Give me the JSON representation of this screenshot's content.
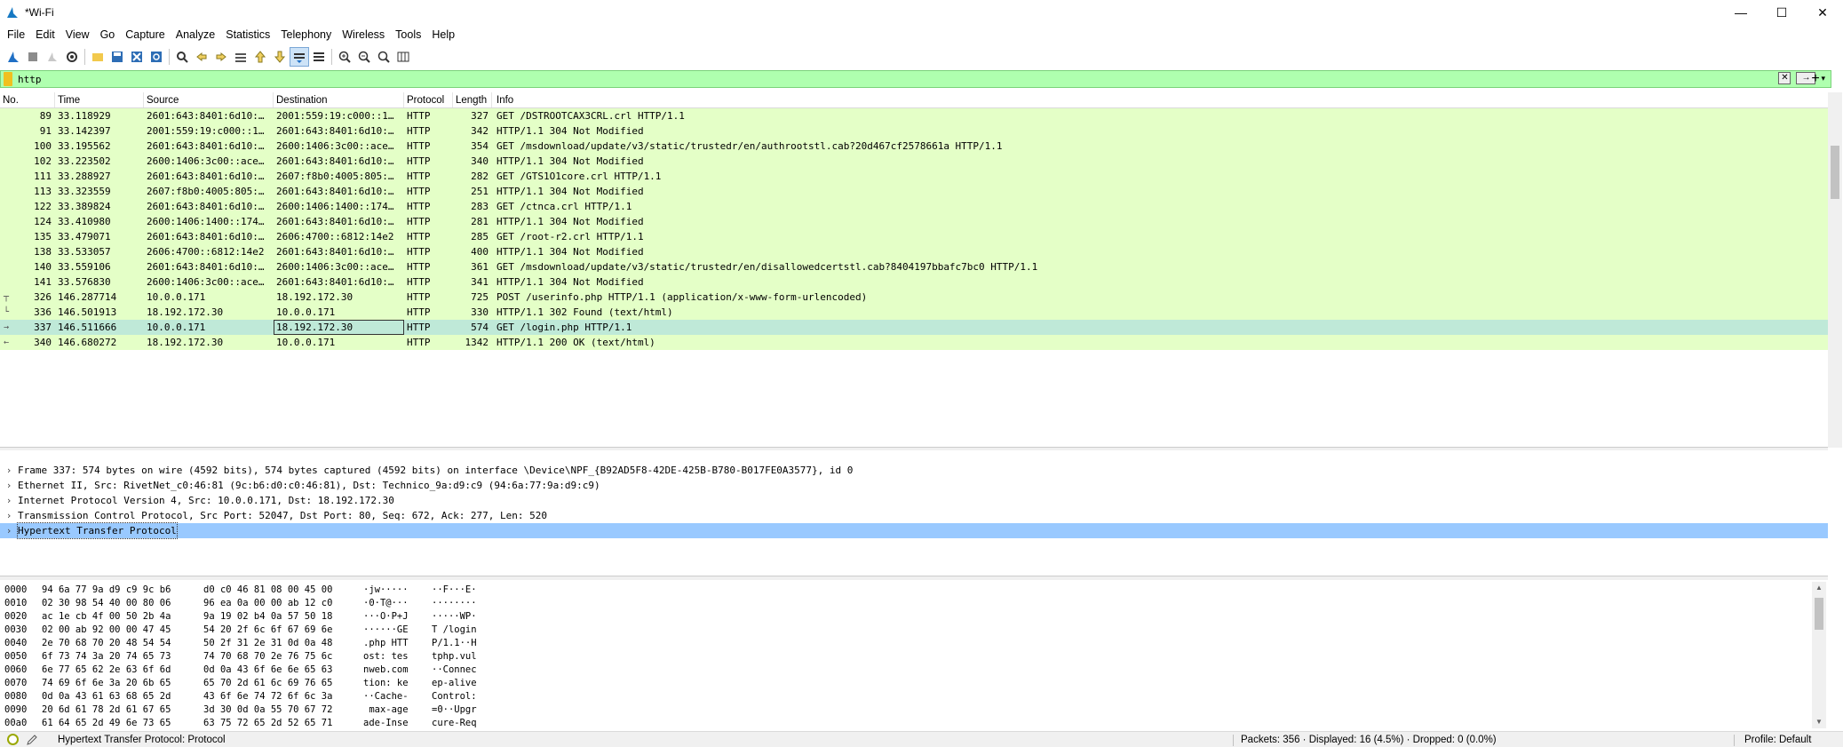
{
  "window": {
    "title": "*Wi-Fi",
    "minimize": "—",
    "maximize": "☐",
    "close": "✕"
  },
  "menu": [
    "File",
    "Edit",
    "View",
    "Go",
    "Capture",
    "Analyze",
    "Statistics",
    "Telephony",
    "Wireless",
    "Tools",
    "Help"
  ],
  "toolbar": {
    "icons": [
      "shark-fin-start-icon",
      "stop-square-icon",
      "restart-icon",
      "capture-options-icon",
      "open-file-icon",
      "save-file-icon",
      "close-file-icon",
      "reload-file-icon",
      "find-packet-icon",
      "go-back-icon",
      "go-forward-icon",
      "go-to-packet-icon",
      "go-first-icon",
      "go-last-icon",
      "auto-scroll-icon",
      "colorize-icon",
      "zoom-in-icon",
      "zoom-out-icon",
      "normal-size-icon",
      "resize-columns-icon"
    ]
  },
  "filter": {
    "value": "http",
    "plus": "+"
  },
  "packet_list": {
    "columns": [
      "No.",
      "Time",
      "Source",
      "Destination",
      "Protocol",
      "Length",
      "Info"
    ],
    "rows": [
      {
        "no": "89",
        "time": "33.118929",
        "src": "2601:643:8401:6d10:…",
        "dst": "2001:559:19:c000::1…",
        "proto": "HTTP",
        "len": "327",
        "info": "GET /DSTROOTCAX3CRL.crl HTTP/1.1",
        "mark": ""
      },
      {
        "no": "91",
        "time": "33.142397",
        "src": "2001:559:19:c000::1…",
        "dst": "2601:643:8401:6d10:…",
        "proto": "HTTP",
        "len": "342",
        "info": "HTTP/1.1 304 Not Modified",
        "mark": ""
      },
      {
        "no": "100",
        "time": "33.195562",
        "src": "2601:643:8401:6d10:…",
        "dst": "2600:1406:3c00::ace…",
        "proto": "HTTP",
        "len": "354",
        "info": "GET /msdownload/update/v3/static/trustedr/en/authrootstl.cab?20d467cf2578661a HTTP/1.1",
        "mark": ""
      },
      {
        "no": "102",
        "time": "33.223502",
        "src": "2600:1406:3c00::ace…",
        "dst": "2601:643:8401:6d10:…",
        "proto": "HTTP",
        "len": "340",
        "info": "HTTP/1.1 304 Not Modified",
        "mark": ""
      },
      {
        "no": "111",
        "time": "33.288927",
        "src": "2601:643:8401:6d10:…",
        "dst": "2607:f8b0:4005:805:…",
        "proto": "HTTP",
        "len": "282",
        "info": "GET /GTS1O1core.crl HTTP/1.1",
        "mark": ""
      },
      {
        "no": "113",
        "time": "33.323559",
        "src": "2607:f8b0:4005:805:…",
        "dst": "2601:643:8401:6d10:…",
        "proto": "HTTP",
        "len": "251",
        "info": "HTTP/1.1 304 Not Modified",
        "mark": ""
      },
      {
        "no": "122",
        "time": "33.389824",
        "src": "2601:643:8401:6d10:…",
        "dst": "2600:1406:1400::174…",
        "proto": "HTTP",
        "len": "283",
        "info": "GET /ctnca.crl HTTP/1.1",
        "mark": ""
      },
      {
        "no": "124",
        "time": "33.410980",
        "src": "2600:1406:1400::174…",
        "dst": "2601:643:8401:6d10:…",
        "proto": "HTTP",
        "len": "281",
        "info": "HTTP/1.1 304 Not Modified",
        "mark": ""
      },
      {
        "no": "135",
        "time": "33.479071",
        "src": "2601:643:8401:6d10:…",
        "dst": "2606:4700::6812:14e2",
        "proto": "HTTP",
        "len": "285",
        "info": "GET /root-r2.crl HTTP/1.1",
        "mark": ""
      },
      {
        "no": "138",
        "time": "33.533057",
        "src": "2606:4700::6812:14e2",
        "dst": "2601:643:8401:6d10:…",
        "proto": "HTTP",
        "len": "400",
        "info": "HTTP/1.1 304 Not Modified",
        "mark": ""
      },
      {
        "no": "140",
        "time": "33.559106",
        "src": "2601:643:8401:6d10:…",
        "dst": "2600:1406:3c00::ace…",
        "proto": "HTTP",
        "len": "361",
        "info": "GET /msdownload/update/v3/static/trustedr/en/disallowedcertstl.cab?8404197bbafc7bc0 HTTP/1.1",
        "mark": ""
      },
      {
        "no": "141",
        "time": "33.576830",
        "src": "2600:1406:3c00::ace…",
        "dst": "2601:643:8401:6d10:…",
        "proto": "HTTP",
        "len": "341",
        "info": "HTTP/1.1 304 Not Modified",
        "mark": ""
      },
      {
        "no": "326",
        "time": "146.287714",
        "src": "10.0.0.171",
        "dst": "18.192.172.30",
        "proto": "HTTP",
        "len": "725",
        "info": "POST /userinfo.php HTTP/1.1  (application/x-www-form-urlencoded)",
        "mark": "┬"
      },
      {
        "no": "336",
        "time": "146.501913",
        "src": "18.192.172.30",
        "dst": "10.0.0.171",
        "proto": "HTTP",
        "len": "330",
        "info": "HTTP/1.1 302 Found  (text/html)",
        "mark": "└"
      },
      {
        "no": "337",
        "time": "146.511666",
        "src": "10.0.0.171",
        "dst": "18.192.172.30",
        "proto": "HTTP",
        "len": "574",
        "info": "GET /login.php HTTP/1.1",
        "mark": "→",
        "selected": true
      },
      {
        "no": "340",
        "time": "146.680272",
        "src": "18.192.172.30",
        "dst": "10.0.0.171",
        "proto": "HTTP",
        "len": "1342",
        "info": "HTTP/1.1 200 OK  (text/html)",
        "mark": "←"
      }
    ]
  },
  "details": {
    "chevron": "›",
    "rows": [
      "Frame 337: 574 bytes on wire (4592 bits), 574 bytes captured (4592 bits) on interface \\Device\\NPF_{B92AD5F8-42DE-425B-B780-B017FE0A3577}, id 0",
      "Ethernet II, Src: RivetNet_c0:46:81 (9c:b6:d0:c0:46:81), Dst: Technico_9a:d9:c9 (94:6a:77:9a:d9:c9)",
      "Internet Protocol Version 4, Src: 10.0.0.171, Dst: 18.192.172.30",
      "Transmission Control Protocol, Src Port: 52047, Dst Port: 80, Seq: 672, Ack: 277, Len: 520",
      "Hypertext Transfer Protocol"
    ]
  },
  "bytes": [
    {
      "off": "0000",
      "h1": "94 6a 77 9a d9 c9 9c b6",
      "h2": "d0 c0 46 81 08 00 45 00",
      "a1": "·jw·····",
      "a2": "··F···E·"
    },
    {
      "off": "0010",
      "h1": "02 30 98 54 40 00 80 06",
      "h2": "96 ea 0a 00 00 ab 12 c0",
      "a1": "·0·T@···",
      "a2": "········"
    },
    {
      "off": "0020",
      "h1": "ac 1e cb 4f 00 50 2b 4a",
      "h2": "9a 19 02 b4 0a 57 50 18",
      "a1": "···O·P+J",
      "a2": "·····WP·"
    },
    {
      "off": "0030",
      "h1": "02 00 ab 92 00 00 47 45",
      "h2": "54 20 2f 6c 6f 67 69 6e",
      "a1": "······GE",
      "a2": "T /login"
    },
    {
      "off": "0040",
      "h1": "2e 70 68 70 20 48 54 54",
      "h2": "50 2f 31 2e 31 0d 0a 48",
      "a1": ".php HTT",
      "a2": "P/1.1··H"
    },
    {
      "off": "0050",
      "h1": "6f 73 74 3a 20 74 65 73",
      "h2": "74 70 68 70 2e 76 75 6c",
      "a1": "ost: tes",
      "a2": "tphp.vul"
    },
    {
      "off": "0060",
      "h1": "6e 77 65 62 2e 63 6f 6d",
      "h2": "0d 0a 43 6f 6e 6e 65 63",
      "a1": "nweb.com",
      "a2": "··Connec"
    },
    {
      "off": "0070",
      "h1": "74 69 6f 6e 3a 20 6b 65",
      "h2": "65 70 2d 61 6c 69 76 65",
      "a1": "tion: ke",
      "a2": "ep-alive"
    },
    {
      "off": "0080",
      "h1": "0d 0a 43 61 63 68 65 2d",
      "h2": "43 6f 6e 74 72 6f 6c 3a",
      "a1": "··Cache-",
      "a2": "Control:"
    },
    {
      "off": "0090",
      "h1": "20 6d 61 78 2d 61 67 65",
      "h2": "3d 30 0d 0a 55 70 67 72",
      "a1": " max-age",
      "a2": "=0··Upgr"
    },
    {
      "off": "00a0",
      "h1": "61 64 65 2d 49 6e 73 65",
      "h2": "63 75 72 65 2d 52 65 71",
      "a1": "ade-Inse",
      "a2": "cure-Req"
    }
  ],
  "status": {
    "message": "Hypertext Transfer Protocol: Protocol",
    "packets": "Packets: 356 · Displayed: 16 (4.5%) · Dropped: 0 (0.0%)",
    "profile": "Profile: Default"
  },
  "colors": {
    "row_bg": "#e4ffc7",
    "selected_row_bg": "#bfe9d8",
    "filter_ok_bg": "#afffaf",
    "detail_selected_bg": "#99c9ff"
  }
}
